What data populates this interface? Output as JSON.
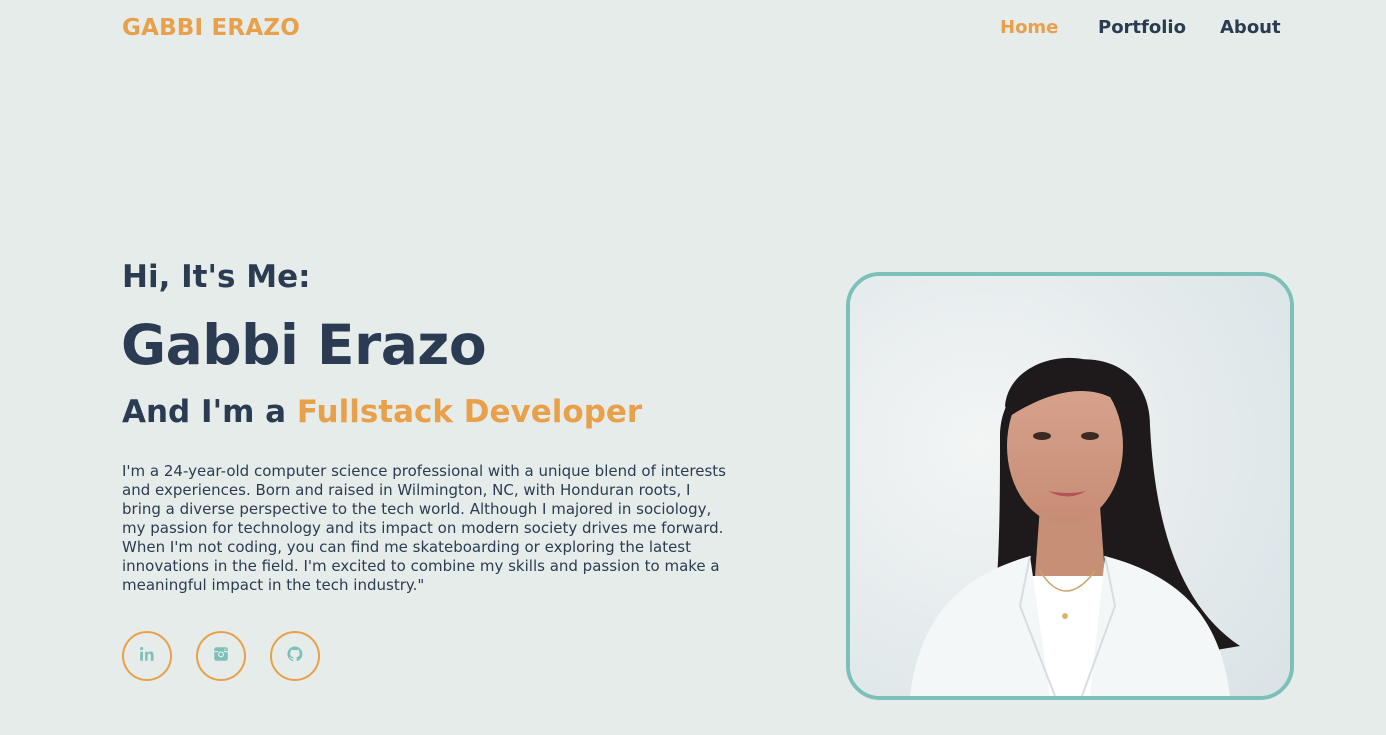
{
  "header": {
    "logo": "GABBI ERAZO",
    "nav": [
      {
        "label": "Home",
        "active": true
      },
      {
        "label": "Portfolio",
        "active": false
      },
      {
        "label": "About",
        "active": false
      }
    ]
  },
  "hero": {
    "greeting": "Hi, It's Me:",
    "name": "Gabbi Erazo",
    "role_prefix": "And I'm a ",
    "role_highlight": "Fullstack Developer",
    "bio": "I'm a 24-year-old computer science professional with a unique blend of interests and experiences. Born and raised in Wilmington, NC, with Honduran roots, I bring a diverse perspective to the tech world. Although I majored in sociology, my passion for technology and its impact on modern society drives me forward. When I'm not coding, you can find me skateboarding or exploring the latest innovations in the field. I'm excited to combine my skills and passion to make a meaningful impact in the tech industry.\""
  },
  "social": [
    {
      "icon": "linkedin-icon"
    },
    {
      "icon": "instagram-icon"
    },
    {
      "icon": "github-icon"
    }
  ],
  "colors": {
    "background": "#e6ece9",
    "accent": "#e8a04a",
    "text": "#2b3c52",
    "icon": "#7cc0b9",
    "portrait_border": "#7cc0b9"
  }
}
